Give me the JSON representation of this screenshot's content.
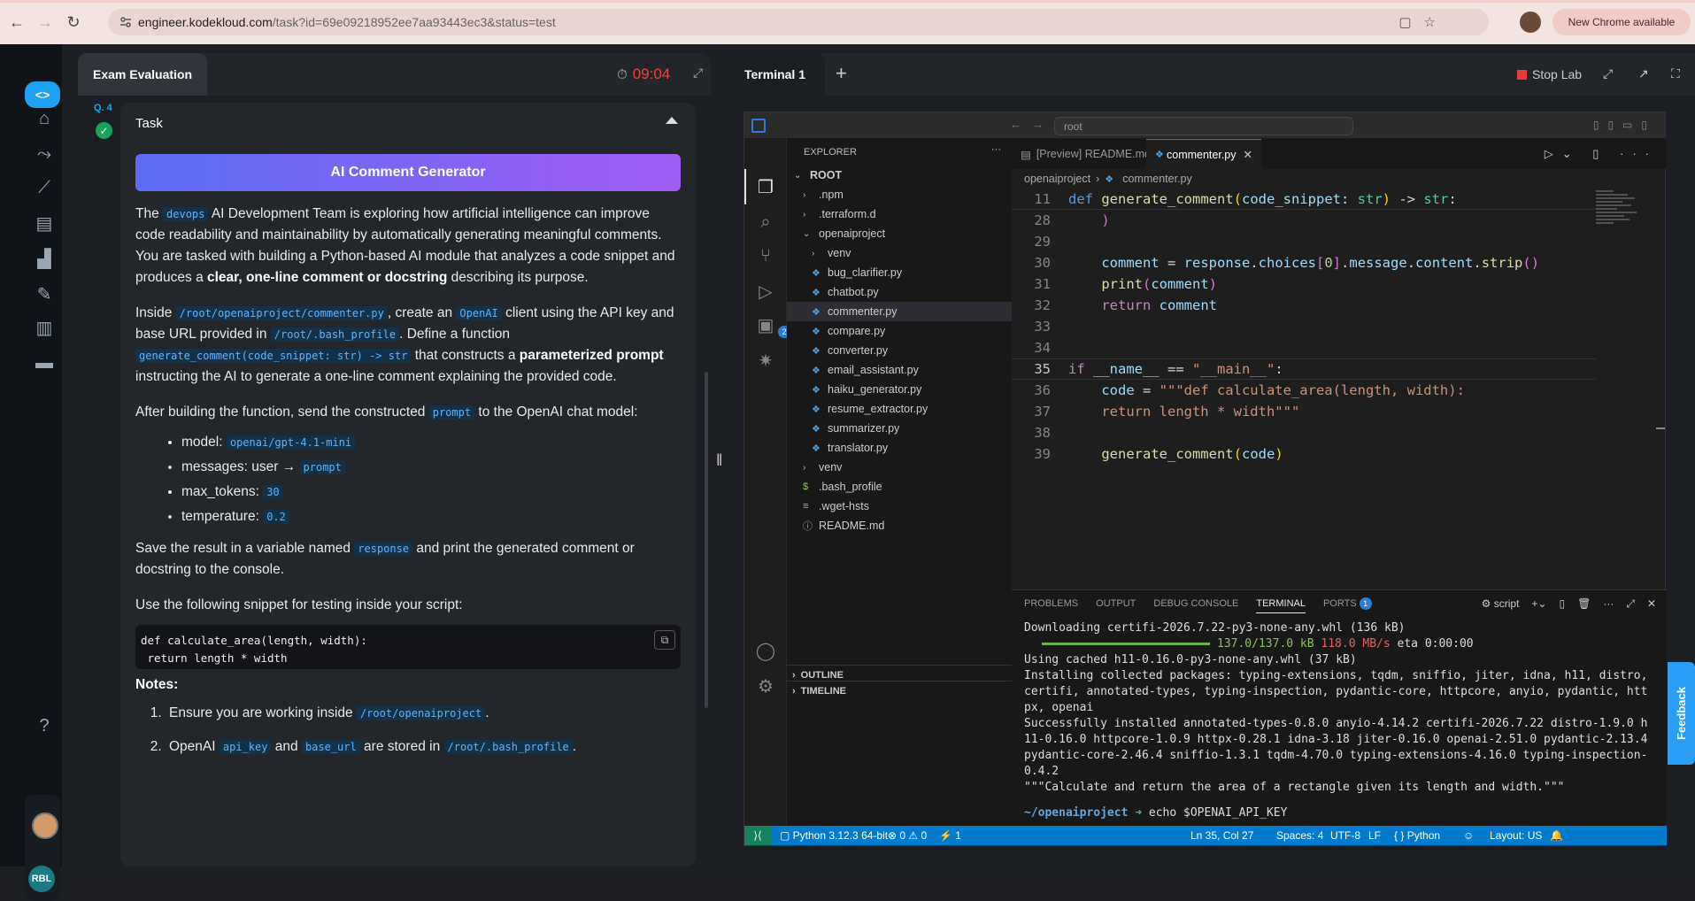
{
  "browser": {
    "url_host": "engineer.kodekloud.com",
    "url_path": "/task?id=69e09218952ee7aa93443ec3&status=test",
    "new_chrome_label": "New Chrome available"
  },
  "rail": {
    "user_initials": "RBL"
  },
  "exam": {
    "tab_title": "Exam Evaluation",
    "timer": "09:04",
    "question_label": "Q. 4",
    "task_header": "Task",
    "task_title": "AI Comment Generator",
    "p1_a": "The ",
    "p1_code": "devops",
    "p1_b": " AI Development Team is exploring how artificial intelligence can improve code readability and maintainability by automatically generating meaningful comments. You are tasked with building a Python-based AI module that analyzes a code snippet and produces a ",
    "p1_bold": "clear, one-line comment or docstring",
    "p1_c": " describing its purpose.",
    "p2_a": "Inside ",
    "p2_code1": "/root/openaiproject/commenter.py",
    "p2_b": ", create an ",
    "p2_code2": "OpenAI",
    "p2_c": " client using the API key and base URL provided in ",
    "p2_code3": "/root/.bash_profile",
    "p2_d": ". Define a function ",
    "p2_code4": "generate_comment(code_snippet: str) -> str",
    "p2_e": " that constructs a ",
    "p2_bold": "parameterized prompt",
    "p2_f": " instructing the AI to generate a one-line comment explaining the provided code.",
    "p3_a": "After building the function, send the constructed ",
    "p3_code": "prompt",
    "p3_b": " to the OpenAI chat model:",
    "params": [
      {
        "label": "model: ",
        "value": "openai/gpt-4.1-mini"
      },
      {
        "label": "messages: user → ",
        "value": "prompt"
      },
      {
        "label": "max_tokens: ",
        "value": "30"
      },
      {
        "label": "temperature: ",
        "value": "0.2"
      }
    ],
    "p4_a": "Save the result in a variable named ",
    "p4_code": "response",
    "p4_b": " and print the generated comment or docstring to the console.",
    "p5": "Use the following snippet for testing inside your script:",
    "snippet_line1": "def calculate_area(length, width):",
    "snippet_line2": " return length * width",
    "notes_title": "Notes:",
    "note1_a": "Ensure you are working inside ",
    "note1_code": "/root/openaiproject",
    "note1_b": ".",
    "note2_a": "OpenAI ",
    "note2_code1": "api_key",
    "note2_b": " and ",
    "note2_code2": "base_url",
    "note2_c": " are stored in ",
    "note2_code3": "/root/.bash_profile",
    "note2_d": "."
  },
  "terminal": {
    "tab_title": "Terminal 1",
    "stop_lab": "Stop Lab"
  },
  "vscode": {
    "command_center": "root",
    "explorer_title": "EXPLORER",
    "tree": [
      {
        "label": "ROOT",
        "depth": 0,
        "kind": "folder-open",
        "bold": true
      },
      {
        "label": ".npm",
        "depth": 1,
        "kind": "folder"
      },
      {
        "label": ".terraform.d",
        "depth": 1,
        "kind": "folder"
      },
      {
        "label": "openaiproject",
        "depth": 1,
        "kind": "folder-open"
      },
      {
        "label": "venv",
        "depth": 2,
        "kind": "folder"
      },
      {
        "label": "bug_clarifier.py",
        "depth": 2,
        "kind": "py"
      },
      {
        "label": "chatbot.py",
        "depth": 2,
        "kind": "py"
      },
      {
        "label": "commenter.py",
        "depth": 2,
        "kind": "py",
        "selected": true
      },
      {
        "label": "compare.py",
        "depth": 2,
        "kind": "py"
      },
      {
        "label": "converter.py",
        "depth": 2,
        "kind": "py"
      },
      {
        "label": "email_assistant.py",
        "depth": 2,
        "kind": "py"
      },
      {
        "label": "haiku_generator.py",
        "depth": 2,
        "kind": "py"
      },
      {
        "label": "resume_extractor.py",
        "depth": 2,
        "kind": "py"
      },
      {
        "label": "summarizer.py",
        "depth": 2,
        "kind": "py"
      },
      {
        "label": "translator.py",
        "depth": 2,
        "kind": "py"
      },
      {
        "label": "venv",
        "depth": 1,
        "kind": "folder"
      },
      {
        "label": ".bash_profile",
        "depth": 1,
        "kind": "shell"
      },
      {
        "label": ".wget-hsts",
        "depth": 1,
        "kind": "text"
      },
      {
        "label": "README.md",
        "depth": 1,
        "kind": "info"
      }
    ],
    "outline": "OUTLINE",
    "timeline": "TIMELINE",
    "tabs": [
      {
        "label": "[Preview] README.md",
        "active": false
      },
      {
        "label": "commenter.py",
        "active": true
      }
    ],
    "breadcrumb": [
      "openaiproject",
      "commenter.py"
    ],
    "panel_tabs": [
      {
        "label": "PROBLEMS"
      },
      {
        "label": "OUTPUT"
      },
      {
        "label": "DEBUG CONSOLE"
      },
      {
        "label": "TERMINAL",
        "active": true
      },
      {
        "label": "PORTS",
        "badge": "1"
      }
    ],
    "panel_script_label": "script",
    "terminal_lines": {
      "l1": "Downloading certifi-2026.7.22-py3-none-any.whl (136 kB)",
      "l2_progress": 1.0,
      "l2_size": "137.0/137.0 kB",
      "l2_speed": "118.0 MB/s",
      "l2_eta": "eta 0:00:00",
      "l3": "Using cached h11-0.16.0-py3-none-any.whl (37 kB)",
      "l4": "Installing collected packages: typing-extensions, tqdm, sniffio, jiter, idna, h11, distro, certifi, annotated-types, typing-inspection, pydantic-core, httpcore, anyio, pydantic, httpx, openai",
      "l5": "Successfully installed annotated-types-0.8.0 anyio-4.14.2 certifi-2026.7.22 distro-1.9.0 h11-0.16.0 httpcore-1.0.9 httpx-0.28.1 idna-3.18 jiter-0.16.0 openai-2.51.0 pydantic-2.13.4 pydantic-core-2.46.4 sniffio-1.3.1 tqdm-4.70.0 typing-extensions-4.16.0 typing-inspection-0.4.2",
      "l6": "\"\"\"Calculate and return the area of a rectangle given its length and width.\"\"\"",
      "prompt_path": "~/openaiproject",
      "prompt_cmd": "echo $OPENAI_API_KEY"
    },
    "status": {
      "python": "Python 3.12.3 64-bit",
      "errors": "0",
      "warnings": "0",
      "ports": "1",
      "position": "Ln 35, Col 27",
      "spaces": "Spaces: 4",
      "encoding": "UTF-8",
      "eol": "LF",
      "language": "Python",
      "layout": "Layout: US"
    }
  },
  "feedback_label": "Feedback"
}
